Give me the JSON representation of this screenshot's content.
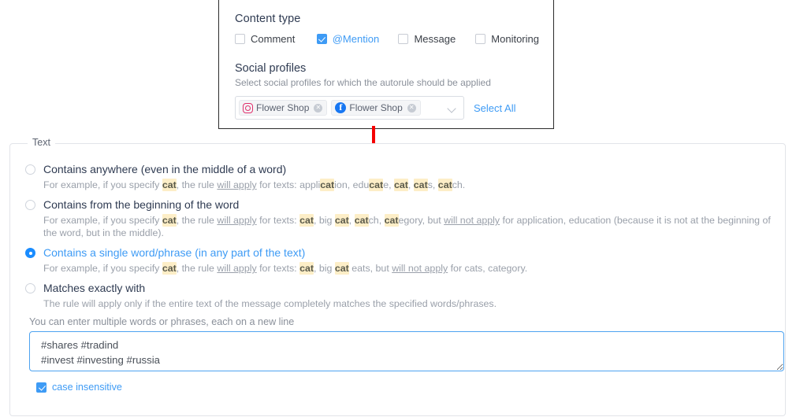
{
  "content_type": {
    "title": "Content type",
    "options": [
      {
        "label": "Comment",
        "checked": false
      },
      {
        "label": "@Mention",
        "checked": true
      },
      {
        "label": "Message",
        "checked": false
      },
      {
        "label": "Monitoring",
        "checked": false
      }
    ]
  },
  "social_profiles": {
    "title": "Social profiles",
    "subtitle": "Select social profiles for which the autorule should be applied",
    "tags": [
      {
        "name": "Flower Shop",
        "network": "instagram"
      },
      {
        "name": "Flower Shop",
        "network": "facebook"
      }
    ],
    "remove_glyph": "✕",
    "facebook_glyph": "f",
    "select_all_label": "Select All"
  },
  "text_section": {
    "legend": "Text",
    "options": [
      {
        "label": "Contains anywhere (even in the middle of a word)",
        "selected": false,
        "desc_parts": [
          {
            "t": "For example, if you specify ",
            "s": "n"
          },
          {
            "t": "cat",
            "s": "hl"
          },
          {
            "t": ", the rule ",
            "s": "n"
          },
          {
            "t": "will apply",
            "s": "ul"
          },
          {
            "t": " for texts: appli",
            "s": "n"
          },
          {
            "t": "cat",
            "s": "hl"
          },
          {
            "t": "ion, edu",
            "s": "n"
          },
          {
            "t": "cat",
            "s": "hl"
          },
          {
            "t": "e, ",
            "s": "n"
          },
          {
            "t": "cat",
            "s": "hl"
          },
          {
            "t": ", ",
            "s": "n"
          },
          {
            "t": "cat",
            "s": "hl"
          },
          {
            "t": "s, ",
            "s": "n"
          },
          {
            "t": "cat",
            "s": "hl"
          },
          {
            "t": "ch.",
            "s": "n"
          }
        ]
      },
      {
        "label": "Contains from the beginning of the word",
        "selected": false,
        "desc_parts": [
          {
            "t": "For example, if you specify ",
            "s": "n"
          },
          {
            "t": "cat",
            "s": "hl"
          },
          {
            "t": ", the rule ",
            "s": "n"
          },
          {
            "t": "will apply",
            "s": "ul"
          },
          {
            "t": " for texts: ",
            "s": "n"
          },
          {
            "t": "cat",
            "s": "hl"
          },
          {
            "t": ", big ",
            "s": "n"
          },
          {
            "t": "cat",
            "s": "hl"
          },
          {
            "t": ", ",
            "s": "n"
          },
          {
            "t": "cat",
            "s": "hl"
          },
          {
            "t": "ch, ",
            "s": "n"
          },
          {
            "t": "cat",
            "s": "hl"
          },
          {
            "t": "egory, but ",
            "s": "n"
          },
          {
            "t": "will not apply",
            "s": "ul"
          },
          {
            "t": " for application, education (because it is not at the beginning of the word, but in the middle).",
            "s": "n"
          }
        ]
      },
      {
        "label": "Contains a single word/phrase (in any part of the text)",
        "selected": true,
        "desc_parts": [
          {
            "t": "For example, if you specify ",
            "s": "n"
          },
          {
            "t": "cat",
            "s": "hl"
          },
          {
            "t": ", the rule ",
            "s": "n"
          },
          {
            "t": "will apply",
            "s": "ul"
          },
          {
            "t": " for texts: ",
            "s": "n"
          },
          {
            "t": "cat",
            "s": "hl"
          },
          {
            "t": ", big ",
            "s": "n"
          },
          {
            "t": "cat",
            "s": "hl"
          },
          {
            "t": " eats, but ",
            "s": "n"
          },
          {
            "t": "will not apply",
            "s": "ul"
          },
          {
            "t": " for cats, category.",
            "s": "n"
          }
        ]
      },
      {
        "label": "Matches exactly with",
        "selected": false,
        "desc_parts": [
          {
            "t": "The rule will apply only if the entire text of the message completely matches the specified words/phrases.",
            "s": "n"
          }
        ]
      }
    ],
    "hint": "You can enter multiple words or phrases, each on a new line",
    "textarea_value": "#shares #tradind\n#invest #investing #russia",
    "textarea_placeholder": "",
    "case_insensitive": {
      "label": "case insensitive",
      "checked": true
    }
  },
  "colors": {
    "accent_blue": "#3e9bf5",
    "radio_blue": "#1a8cff",
    "highlight_yellow": "#fdeec7",
    "arrow_red": "#f50000",
    "instagram": "#e1306c",
    "facebook": "#1877f2"
  }
}
